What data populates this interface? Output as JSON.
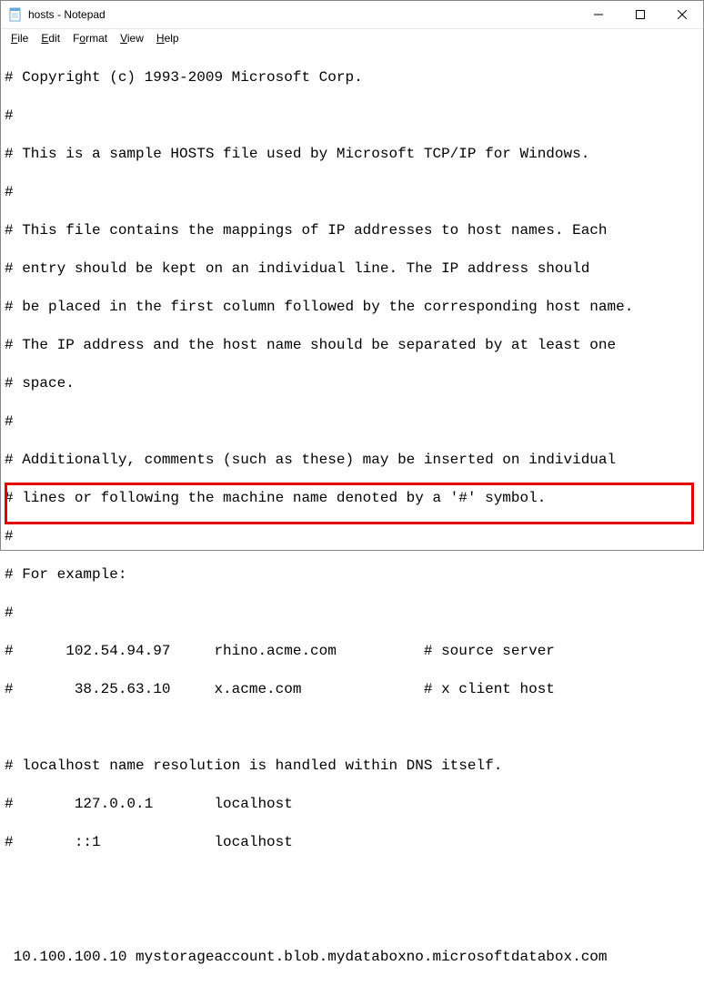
{
  "window": {
    "title": "hosts - Notepad"
  },
  "menu": {
    "file": "File",
    "edit": "Edit",
    "format": "Format",
    "view": "View",
    "help": "Help"
  },
  "content": {
    "lines": [
      "# Copyright (c) 1993-2009 Microsoft Corp.",
      "#",
      "# This is a sample HOSTS file used by Microsoft TCP/IP for Windows.",
      "#",
      "# This file contains the mappings of IP addresses to host names. Each",
      "# entry should be kept on an individual line. The IP address should",
      "# be placed in the first column followed by the corresponding host name.",
      "# The IP address and the host name should be separated by at least one",
      "# space.",
      "#",
      "# Additionally, comments (such as these) may be inserted on individual",
      "# lines or following the machine name denoted by a '#' symbol.",
      "#",
      "# For example:",
      "#",
      "#      102.54.94.97     rhino.acme.com          # source server",
      "#       38.25.63.10     x.acme.com              # x client host",
      "",
      "# localhost name resolution is handled within DNS itself.",
      "#       127.0.0.1       localhost",
      "#       ::1             localhost",
      "",
      "",
      " 10.100.100.10 mystorageaccount.blob.mydataboxno.microsoftdatabox.com"
    ]
  }
}
